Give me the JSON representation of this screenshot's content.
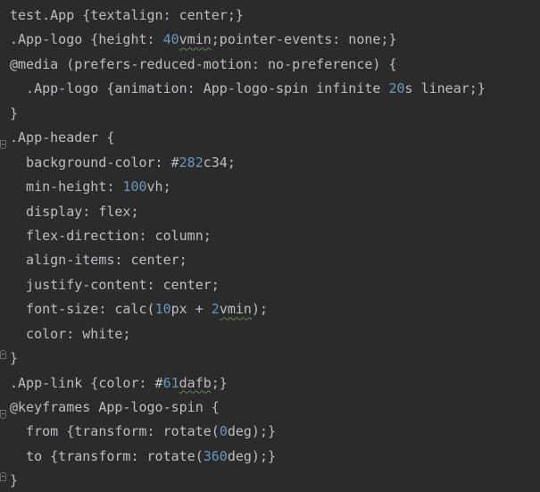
{
  "editor": {
    "lines": [
      {
        "segments": [
          {
            "t": "test.App {textalign: center;}"
          }
        ]
      },
      {
        "segments": [
          {
            "t": ".App-logo {height: "
          },
          {
            "t": "40",
            "c": "num"
          },
          {
            "t": "vmin",
            "c": "typo"
          },
          {
            "t": ";pointer-events: none;}"
          }
        ]
      },
      {
        "segments": [
          {
            "t": "@media (prefers-reduced-motion: no-preference) {"
          }
        ]
      },
      {
        "segments": [
          {
            "t": "  .App-logo {animation: App-logo-spin infinite "
          },
          {
            "t": "20",
            "c": "num"
          },
          {
            "t": "s linear;}"
          }
        ]
      },
      {
        "segments": [
          {
            "t": "}"
          }
        ]
      },
      {
        "segments": [
          {
            "t": ".App-header {"
          }
        ],
        "fold": "open"
      },
      {
        "segments": [
          {
            "t": "  background-color: #"
          },
          {
            "t": "282",
            "c": "num"
          },
          {
            "t": "c34;"
          }
        ]
      },
      {
        "segments": [
          {
            "t": "  min-height: "
          },
          {
            "t": "100",
            "c": "num"
          },
          {
            "t": "vh;"
          }
        ]
      },
      {
        "segments": [
          {
            "t": "  display: flex;"
          }
        ]
      },
      {
        "segments": [
          {
            "t": "  flex-direction: column;"
          }
        ]
      },
      {
        "segments": [
          {
            "t": "  align-items: center;"
          }
        ]
      },
      {
        "segments": [
          {
            "t": "  justify-content: center;"
          }
        ]
      },
      {
        "segments": [
          {
            "t": "  font-size: calc("
          },
          {
            "t": "10",
            "c": "num"
          },
          {
            "t": "px + "
          },
          {
            "t": "2",
            "c": "num"
          },
          {
            "t": "vmin",
            "c": "typo"
          },
          {
            "t": ");"
          }
        ]
      },
      {
        "segments": [
          {
            "t": "  color: white;"
          }
        ]
      },
      {
        "segments": [
          {
            "t": "}"
          }
        ],
        "fold": "close"
      },
      {
        "segments": [
          {
            "t": ".App-link {color: #"
          },
          {
            "t": "61",
            "c": "num"
          },
          {
            "t": "dafb",
            "c": "typo"
          },
          {
            "t": ";}"
          }
        ]
      },
      {
        "segments": [
          {
            "t": "@keyframes App-logo-spin {"
          }
        ],
        "fold": "open"
      },
      {
        "segments": [
          {
            "t": "  from {transform: rotate("
          },
          {
            "t": "0",
            "c": "num"
          },
          {
            "t": "deg);}"
          }
        ]
      },
      {
        "segments": [
          {
            "t": "  to {transform: rotate("
          },
          {
            "t": "360",
            "c": "num"
          },
          {
            "t": "deg);}"
          }
        ]
      },
      {
        "segments": [
          {
            "t": "}"
          }
        ],
        "fold": "close"
      }
    ]
  },
  "colors": {
    "background": "#2b2b2b",
    "text": "#bcbec4",
    "number": "#6897bb",
    "typo_underline": "#5f8a4b"
  },
  "icons": {
    "fold_open": "fold-open-icon",
    "fold_close": "fold-close-icon"
  }
}
